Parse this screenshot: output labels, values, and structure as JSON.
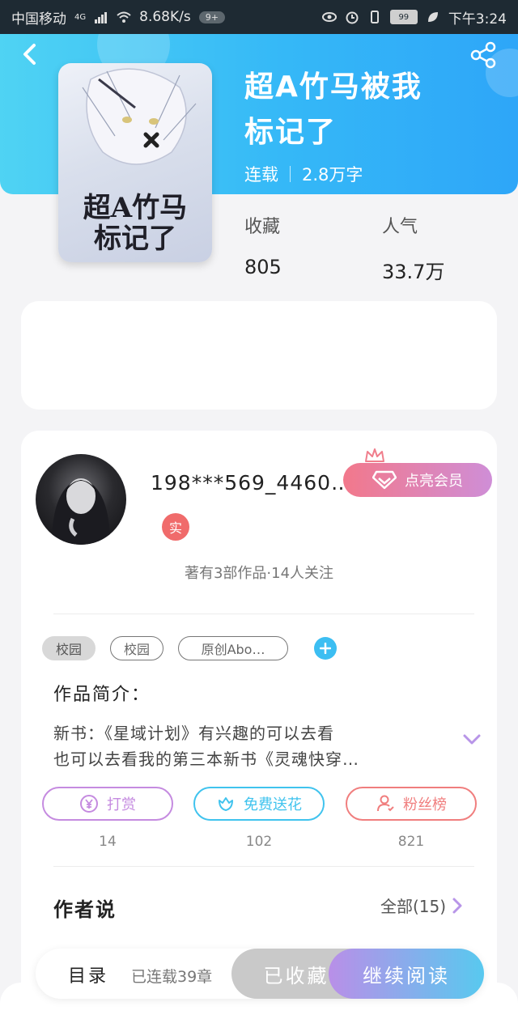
{
  "status_bar": {
    "carrier": "中国移动",
    "network": "4G",
    "speed": "8.68K/s",
    "notif_count": "9+",
    "battery": "99",
    "time": "下午3:24"
  },
  "book": {
    "title_line1": "超A竹马被我",
    "title_line2": "标记了",
    "status": "连载",
    "word_count": "2.8万字",
    "cover_title_line1": "超A竹马",
    "cover_title_line2": "标记了",
    "stats": {
      "collect_label": "收藏",
      "collect_value": "805",
      "popularity_label": "人气",
      "popularity_value": "33.7万"
    }
  },
  "author": {
    "name": "198***569_4460…",
    "verified_label": "实",
    "vip_button": "点亮会员",
    "summary": "著有3部作品·14人关注"
  },
  "tags": [
    "校园",
    "校园",
    "原创Abo…"
  ],
  "intro": {
    "title": "作品简介：",
    "line1": "新书：《星域计划》有兴趣的可以去看",
    "line2": "也可以去看我的第三本新书《灵魂快穿…"
  },
  "actions": [
    {
      "label": "打赏",
      "count": "14",
      "color": "#c58be0"
    },
    {
      "label": "免费送花",
      "count": "102",
      "color": "#40c3ee"
    },
    {
      "label": "粉丝榜",
      "count": "821",
      "color": "#f07e7e"
    }
  ],
  "author_say": {
    "title": "作者说",
    "all_label": "全部(15)"
  },
  "bottom_bar": {
    "toc": "目录",
    "serial": "已连载39章",
    "collected": "已收藏",
    "read": "继续阅读"
  },
  "colors": {
    "hero_start": "#4fd3f3",
    "hero_end": "#2ea6f8",
    "vip_start": "#f2788b",
    "vip_end": "#cf8ed7"
  }
}
